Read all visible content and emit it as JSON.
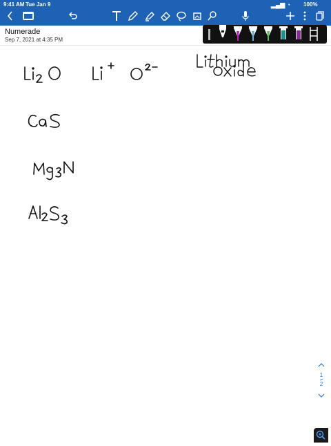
{
  "status_bar": {
    "time": "9:41 AM",
    "date": "Tue Jan 9",
    "battery": "100%"
  },
  "document": {
    "title": "Numerade",
    "date": "Sep 7, 2021 at 4:35 PM"
  },
  "toolbar": {
    "left_icons": [
      "back-chevron-icon",
      "documents-icon",
      "undo-icon"
    ],
    "tool_icons": [
      "text-tool-icon",
      "pen-tool-icon",
      "highlighter-icon",
      "eraser-icon",
      "lasso-icon",
      "image-tool-icon",
      "shapes-tool-icon"
    ],
    "right_icons": [
      "microphone-icon",
      "add-page-icon",
      "more-icon",
      "page-thumbnails-icon"
    ]
  },
  "pen_tray": {
    "pens": [
      {
        "name": "black-pen",
        "color": "#1a1a1a"
      },
      {
        "name": "magenta-pen",
        "color": "#c21cc2"
      },
      {
        "name": "light-blue-pen",
        "color": "#60b8e0"
      },
      {
        "name": "green-pen",
        "color": "#58c060"
      },
      {
        "name": "teal-pen",
        "color": "#209090"
      },
      {
        "name": "purple-pen",
        "color": "#8a2a9a"
      }
    ]
  },
  "handwritten_notes": [
    "Li₂O",
    "Li⁺",
    "O²⁻",
    "Lithium",
    "oxide",
    "CaS",
    "Mg₃N",
    "Al₂S₃"
  ],
  "page_nav": {
    "current": "1",
    "total": "2"
  },
  "colors": {
    "toolbar": "#1d62b5",
    "ink": "#111111",
    "accent": "#2a7ad9"
  }
}
